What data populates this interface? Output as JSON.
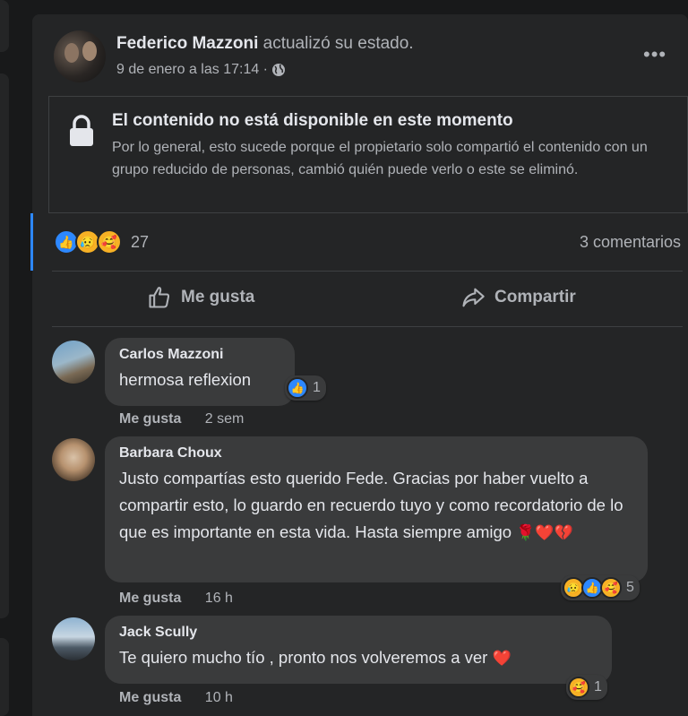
{
  "post": {
    "author": "Federico Mazzoni",
    "action": "actualizó su estado.",
    "timestamp": "9 de enero a las 17:14 ·",
    "privacy_icon": "globe-icon",
    "more_label": "•••"
  },
  "unavailable": {
    "title": "El contenido no está disponible en este momento",
    "body": "Por lo general, esto sucede porque el propietario solo compartió el contenido con un grupo reducido de personas, cambió quién puede verlo o este se eliminó."
  },
  "reactions": {
    "types": [
      "like",
      "sad",
      "care"
    ],
    "count": "27",
    "comments": "3 comentarios"
  },
  "actions": {
    "like_label": "Me gusta",
    "share_label": "Compartir"
  },
  "comments": [
    {
      "author": "Carlos Mazzoni",
      "text": "hermosa reflexion",
      "like_label": "Me gusta",
      "time": "2 sem",
      "reaction_types": [
        "like"
      ],
      "reaction_count": "1"
    },
    {
      "author": "Barbara Choux",
      "text": "Justo compartías esto querido Fede. Gracias por haber vuelto a compartir esto, lo guardo en recuerdo tuyo y como recordatorio de lo que es importante en esta vida. Hasta siempre amigo",
      "text_emojis": "🌹❤️💔",
      "like_label": "Me gusta",
      "time": "16 h",
      "reaction_types": [
        "sad",
        "like",
        "care"
      ],
      "reaction_count": "5"
    },
    {
      "author": "Jack Scully",
      "text": "Te quiero mucho tío , pronto nos volveremos a ver",
      "text_emojis": "❤️",
      "like_label": "Me gusta",
      "time": "10 h",
      "reaction_types": [
        "care"
      ],
      "reaction_count": "1"
    }
  ],
  "colors": {
    "background": "#18191a",
    "card": "#242526",
    "bubble": "#3a3b3c",
    "accent": "#2d88ff",
    "text_primary": "#e4e6eb",
    "text_secondary": "#b0b3b8"
  }
}
